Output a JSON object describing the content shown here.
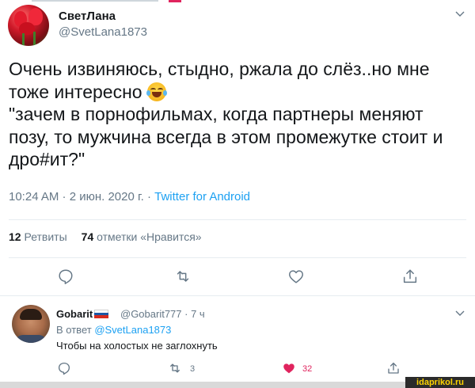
{
  "colors": {
    "text": "#14171a",
    "secondary": "#657786",
    "link": "#1da1f2",
    "like": "#e0245e",
    "divider": "#e6ecf0"
  },
  "main_tweet": {
    "author_name": "СветЛана",
    "author_handle": "@SvetLana1873",
    "text_line1": "Очень извиняюсь, стыдно, ржала до слёз..но мне",
    "text_line2": "тоже интересно ",
    "text_rest": "\n\"зачем в порнофильмах, когда партнеры меняют\nпозу, то мужчина всегда в этом промежутке стоит и\nдро#ит?\"",
    "emoji_icon": "face-with-tears-of-joy-icon",
    "timestamp": "10:24 AM · 2 июн. 2020 г. · ",
    "source": "Twitter for Android",
    "retweets_count": "12",
    "retweets_label": "Ретвиты",
    "likes_count": "74",
    "likes_label": "отметки «Нравится»",
    "actions": [
      "reply-icon",
      "retweet-icon",
      "like-icon",
      "share-icon"
    ]
  },
  "reply": {
    "author_name": "Gobarit",
    "flag_icon": "russia-flag-icon",
    "author_handle": "@Gobarit777 · 7 ч",
    "reply_to_label": "В ответ ",
    "reply_to_mention": "@SvetLana1873",
    "text": "Чтобы на холостых не заглохнуть",
    "retweet_count": "3",
    "like_count": "32"
  },
  "watermark": "idaprikol.ru"
}
